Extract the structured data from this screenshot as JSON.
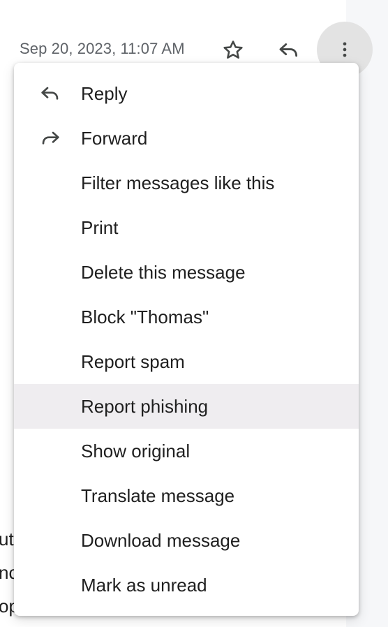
{
  "header": {
    "timestamp": "Sep 20, 2023, 11:07 AM",
    "icons": [
      "star-icon",
      "reply-icon",
      "more-vert-icon"
    ]
  },
  "body_fragments": [
    "ut",
    "nc",
    "op"
  ],
  "menu": {
    "items": [
      {
        "label": "Reply",
        "icon": "reply-icon"
      },
      {
        "label": "Forward",
        "icon": "forward-icon"
      },
      {
        "label": "Filter messages like this"
      },
      {
        "label": "Print"
      },
      {
        "label": "Delete this message"
      },
      {
        "label": "Block \"Thomas\""
      },
      {
        "label": "Report spam"
      },
      {
        "label": "Report phishing",
        "highlighted": true
      },
      {
        "label": "Show original"
      },
      {
        "label": "Translate message"
      },
      {
        "label": "Download message"
      },
      {
        "label": "Mark as unread"
      }
    ]
  },
  "colors": {
    "text": "#1f1f1f",
    "muted": "#5f6368",
    "hover": "#efedf0",
    "more_button_bg": "#e3e3e3"
  }
}
